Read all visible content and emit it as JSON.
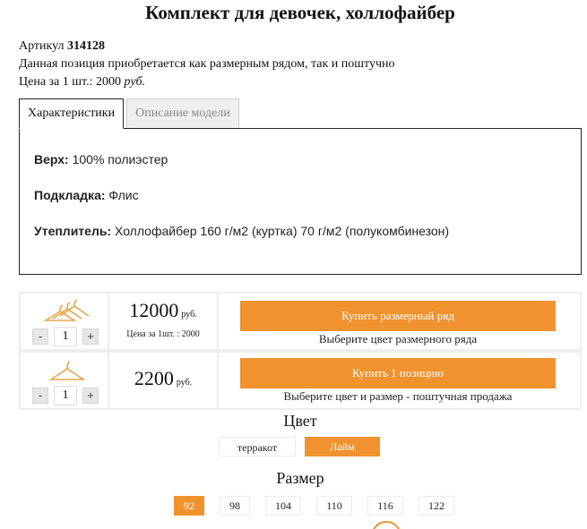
{
  "product": {
    "title": "Комплект для девочек, холлофайбер",
    "sku_label": "Артикул",
    "sku_value": "314128",
    "purchase_note": "Данная позиция приобретается как размерным рядом, так и поштучно",
    "unit_price_label": "Цена за 1 шт.: 2000",
    "unit_price_currency": "руб."
  },
  "tabs": [
    {
      "label": "Характеристики",
      "active": true
    },
    {
      "label": "Описание модели",
      "active": false
    }
  ],
  "specs": [
    {
      "name": "Верх:",
      "value": "100% полиэстер"
    },
    {
      "name": "Подкладка:",
      "value": "Флис"
    },
    {
      "name": "Утеплитель:",
      "value": "Холлофайбер 160 г/м2 (куртка) 70 г/м2 (полукомбинезон)"
    }
  ],
  "buy_options": [
    {
      "icon": "hanger-set-icon",
      "quantity": "1",
      "price": "12000",
      "currency": "руб.",
      "price_note": "Цена за 1шт. : 2000",
      "button_label": "Купить размерный ряд",
      "hint": "Выберите цвет размерного ряда"
    },
    {
      "icon": "hanger-icon",
      "quantity": "1",
      "price": "2200",
      "currency": "руб.",
      "price_note": "",
      "button_label": "Купить 1 позицию",
      "hint": "Выберите цвет и размер - поштучная продажа"
    }
  ],
  "stepper": {
    "minus": "-",
    "plus": "+"
  },
  "color_section": {
    "title": "Цвет",
    "options": [
      {
        "label": "терракот",
        "selected": false
      },
      {
        "label": "Лайм",
        "selected": true
      }
    ]
  },
  "size_section": {
    "title": "Размер",
    "options": [
      {
        "label": "92",
        "selected": true
      },
      {
        "label": "98",
        "selected": false
      },
      {
        "label": "104",
        "selected": false
      },
      {
        "label": "110",
        "selected": false
      },
      {
        "label": "116",
        "selected": false
      },
      {
        "label": "122",
        "selected": false
      }
    ]
  },
  "colors": {
    "accent": "#f0922e",
    "border": "#222222",
    "panel_bg": "#eeeeee"
  }
}
